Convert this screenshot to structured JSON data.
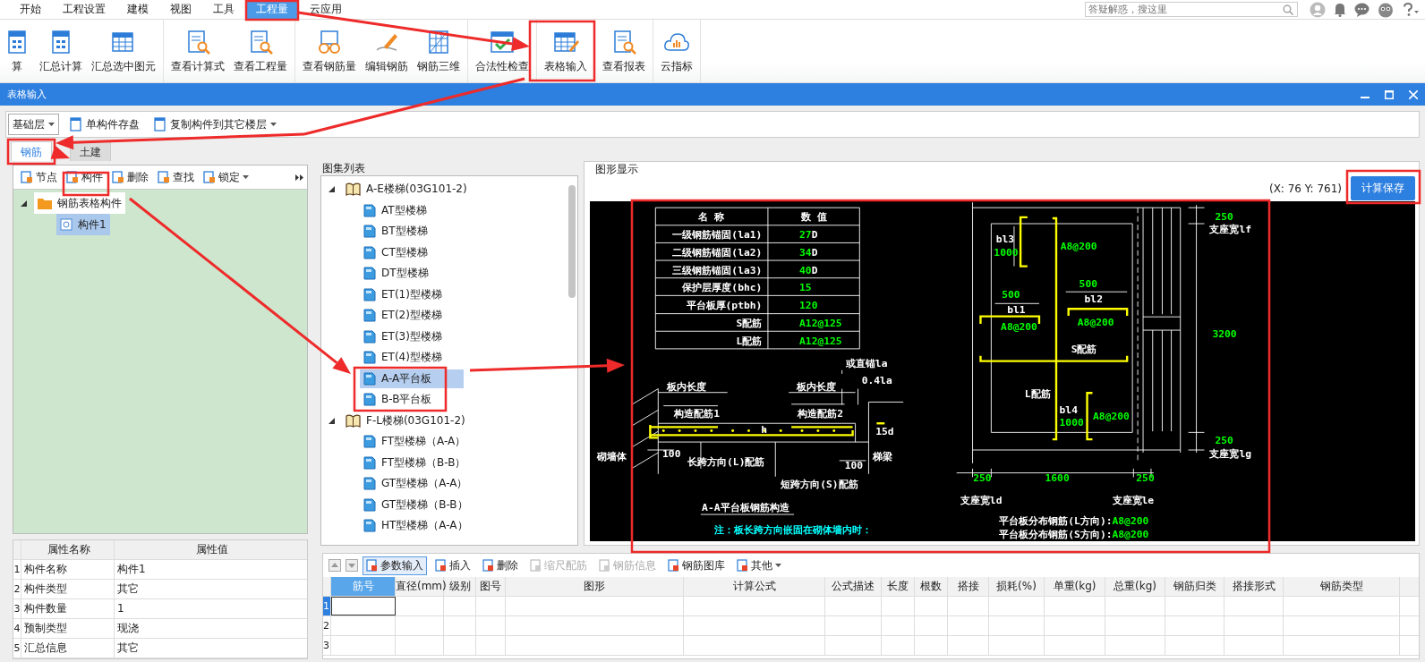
{
  "menu": {
    "tabs": [
      {
        "label": "开始",
        "selected": false
      },
      {
        "label": "工程设置",
        "selected": false
      },
      {
        "label": "建模",
        "selected": false
      },
      {
        "label": "视图",
        "selected": false
      },
      {
        "label": "工具",
        "selected": false
      },
      {
        "label": "工程量",
        "selected": true
      },
      {
        "label": "云应用",
        "selected": false
      }
    ],
    "search": {
      "placeholder": "答疑解惑，搜这里"
    }
  },
  "ribbon": {
    "groups": [
      {
        "items": [
          {
            "label": "算"
          },
          {
            "label": "汇总计算"
          },
          {
            "label": "汇总选中图元"
          }
        ]
      },
      {
        "items": [
          {
            "label": "查看计算式"
          },
          {
            "label": "查看工程量"
          }
        ]
      },
      {
        "items": [
          {
            "label": "查看钢筋量"
          },
          {
            "label": "编辑钢筋"
          },
          {
            "label": "钢筋三维"
          }
        ]
      },
      {
        "items": [
          {
            "label": "合法性检查"
          }
        ]
      },
      {
        "items": [
          {
            "label": "表格输入"
          }
        ]
      },
      {
        "items": [
          {
            "label": "查看报表"
          }
        ]
      },
      {
        "items": [
          {
            "label": "云指标"
          }
        ]
      }
    ]
  },
  "dialog": {
    "title": "表格输入"
  },
  "toolbar": {
    "floor": "基础层",
    "buttons": [
      {
        "label": "单构件存盘",
        "dropdown": false
      },
      {
        "label": "复制构件到其它楼层",
        "dropdown": true
      }
    ]
  },
  "tabs": [
    {
      "label": "钢筋",
      "selected": true
    },
    {
      "label": "土建",
      "selected": false
    }
  ],
  "component_panel": {
    "tools": [
      {
        "label": "节点",
        "dropdown": false
      },
      {
        "label": "构件",
        "dropdown": false
      },
      {
        "label": "删除",
        "dropdown": false
      },
      {
        "label": "查找",
        "dropdown": false
      },
      {
        "label": "锁定",
        "dropdown": true
      }
    ],
    "tree": [
      {
        "label": "钢筋表格构件",
        "expanded": true,
        "selected": false,
        "children": [
          {
            "label": "构件1",
            "selected": true
          }
        ]
      }
    ]
  },
  "properties": {
    "columns": [
      "属性名称",
      "属性值"
    ],
    "rows": [
      {
        "index": "1",
        "name": "构件名称",
        "value": "构件1"
      },
      {
        "index": "2",
        "name": "构件类型",
        "value": "其它"
      },
      {
        "index": "3",
        "name": "构件数量",
        "value": "1"
      },
      {
        "index": "4",
        "name": "预制类型",
        "value": "现浇"
      },
      {
        "index": "5",
        "name": "汇总信息",
        "value": "其它"
      }
    ]
  },
  "atlas": {
    "title": "图集列表",
    "groups": [
      {
        "label": "A-E楼梯(03G101-2)",
        "expanded": true,
        "children": [
          {
            "label": "AT型楼梯",
            "selected": false
          },
          {
            "label": "BT型楼梯",
            "selected": false
          },
          {
            "label": "CT型楼梯",
            "selected": false
          },
          {
            "label": "DT型楼梯",
            "selected": false
          },
          {
            "label": "ET(1)型楼梯",
            "selected": false
          },
          {
            "label": "ET(2)型楼梯",
            "selected": false
          },
          {
            "label": "ET(3)型楼梯",
            "selected": false
          },
          {
            "label": "ET(4)型楼梯",
            "selected": false
          },
          {
            "label": "A-A平台板",
            "selected": true
          },
          {
            "label": "B-B平台板",
            "selected": false
          }
        ]
      },
      {
        "label": "F-L楼梯(03G101-2)",
        "expanded": true,
        "children": [
          {
            "label": "FT型楼梯（A-A）",
            "selected": false
          },
          {
            "label": "FT型楼梯（B-B）",
            "selected": false
          },
          {
            "label": "GT型楼梯（A-A）",
            "selected": false
          },
          {
            "label": "GT型楼梯（B-B）",
            "selected": false
          },
          {
            "label": "HT型楼梯（A-A）",
            "selected": false
          }
        ]
      }
    ]
  },
  "graphics": {
    "title": "图形显示",
    "coords": "(X: 76 Y: 761)",
    "save_button": "计算保存",
    "drawing": {
      "table_header": [
        "名 称",
        "数 值"
      ],
      "table_rows": [
        {
          "name": "一级钢筋锚固(la1)",
          "value": "27",
          "unit": "D"
        },
        {
          "name": "二级钢筋锚固(la2)",
          "value": "34",
          "unit": "D"
        },
        {
          "name": "三级钢筋锚固(la3)",
          "value": "40",
          "unit": "D"
        },
        {
          "name": "保护层厚度(bhc)",
          "value": "15"
        },
        {
          "name": "平台板厚(ptbh)",
          "value": "120"
        },
        {
          "name": "S配筋",
          "value": "A12@125"
        },
        {
          "name": "L配筋",
          "value": "A12@125"
        }
      ],
      "labels": [
        {
          "text": "或直锚la",
          "color": "#ffffff"
        },
        {
          "text": "0.4la",
          "color": "#ffffff"
        },
        {
          "text": "板内长度",
          "color": "#ffffff"
        },
        {
          "text": "板内长度",
          "color": "#ffffff"
        },
        {
          "text": "构造配筋1",
          "color": "#ffffff"
        },
        {
          "text": "构造配筋2",
          "color": "#ffffff"
        },
        {
          "text": "h",
          "color": "#ffffff"
        },
        {
          "text": "15d",
          "color": "#ffffff"
        },
        {
          "text": "砌墙体",
          "color": "#ffffff"
        },
        {
          "text": "100",
          "color": "#ffffff"
        },
        {
          "text": "长跨方向(L)配筋",
          "color": "#ffffff"
        },
        {
          "text": "100",
          "color": "#ffffff"
        },
        {
          "text": "梯梁",
          "color": "#ffffff"
        },
        {
          "text": "短跨方向(S)配筋",
          "color": "#ffffff"
        },
        {
          "text": "250",
          "color": "#00ff00"
        },
        {
          "text": "支座宽lf",
          "color": "#ffffff"
        },
        {
          "text": "bl3",
          "color": "#ffffff"
        },
        {
          "text": "1000",
          "color": "#00ff00"
        },
        {
          "text": "A8@200",
          "color": "#00ff00"
        },
        {
          "text": "500",
          "color": "#00ff00"
        },
        {
          "text": "bl1",
          "color": "#ffffff"
        },
        {
          "text": "A8@200",
          "color": "#00ff00"
        },
        {
          "text": "500",
          "color": "#00ff00"
        },
        {
          "text": "bl2",
          "color": "#ffffff"
        },
        {
          "text": "A8@200",
          "color": "#00ff00"
        },
        {
          "text": "3200",
          "color": "#00ff00"
        },
        {
          "text": "S配筋",
          "color": "#ffffff"
        },
        {
          "text": "L配筋",
          "color": "#ffffff"
        },
        {
          "text": "bl4",
          "color": "#ffffff"
        },
        {
          "text": "1000",
          "color": "#00ff00"
        },
        {
          "text": "A8@200",
          "color": "#00ff00"
        },
        {
          "text": "250",
          "color": "#00ff00"
        },
        {
          "text": "支座宽lg",
          "color": "#ffffff"
        },
        {
          "text": "250",
          "color": "#00ff00"
        },
        {
          "text": "1600",
          "color": "#00ff00"
        },
        {
          "text": "250",
          "color": "#00ff00"
        },
        {
          "text": "支座宽ld",
          "color": "#ffffff"
        },
        {
          "text": "支座宽le",
          "color": "#ffffff"
        }
      ],
      "caption": "A-A平台板钢筋构造",
      "note": "注：板长跨方向嵌固在砌体墙内时：",
      "legend": [
        {
          "label": "平台板分布钢筋(L方向):",
          "value": "A8@200"
        },
        {
          "label": "平台板分布钢筋(S方向):",
          "value": "A8@200"
        }
      ]
    }
  },
  "rebar_grid": {
    "tools": [
      {
        "label": "参数输入",
        "on": true,
        "disabled": false,
        "dropdown": false
      },
      {
        "label": "插入",
        "on": false,
        "disabled": false,
        "dropdown": false
      },
      {
        "label": "删除",
        "on": false,
        "disabled": false,
        "dropdown": false
      },
      {
        "label": "缩尺配筋",
        "on": false,
        "disabled": true,
        "dropdown": false
      },
      {
        "label": "钢筋信息",
        "on": false,
        "disabled": true,
        "dropdown": false
      },
      {
        "label": "钢筋图库",
        "on": false,
        "disabled": false,
        "dropdown": false
      },
      {
        "label": "其他",
        "on": false,
        "disabled": false,
        "dropdown": true
      }
    ],
    "columns": [
      {
        "label": "筋号",
        "selected": true
      },
      {
        "label": "直径(mm)",
        "selected": false
      },
      {
        "label": "级别",
        "selected": false
      },
      {
        "label": "图号",
        "selected": false
      },
      {
        "label": "图形",
        "selected": false
      },
      {
        "label": "计算公式",
        "selected": false
      },
      {
        "label": "公式描述",
        "selected": false
      },
      {
        "label": "长度",
        "selected": false
      },
      {
        "label": "根数",
        "selected": false
      },
      {
        "label": "搭接",
        "selected": false
      },
      {
        "label": "损耗(%)",
        "selected": false
      },
      {
        "label": "单重(kg)",
        "selected": false
      },
      {
        "label": "总重(kg)",
        "selected": false
      },
      {
        "label": "钢筋归类",
        "selected": false
      },
      {
        "label": "搭接形式",
        "selected": false
      },
      {
        "label": "钢筋类型",
        "selected": false
      }
    ],
    "rows": [
      {
        "index": "1",
        "selected": true
      },
      {
        "index": "2",
        "selected": false
      },
      {
        "index": "3",
        "selected": false
      }
    ]
  }
}
